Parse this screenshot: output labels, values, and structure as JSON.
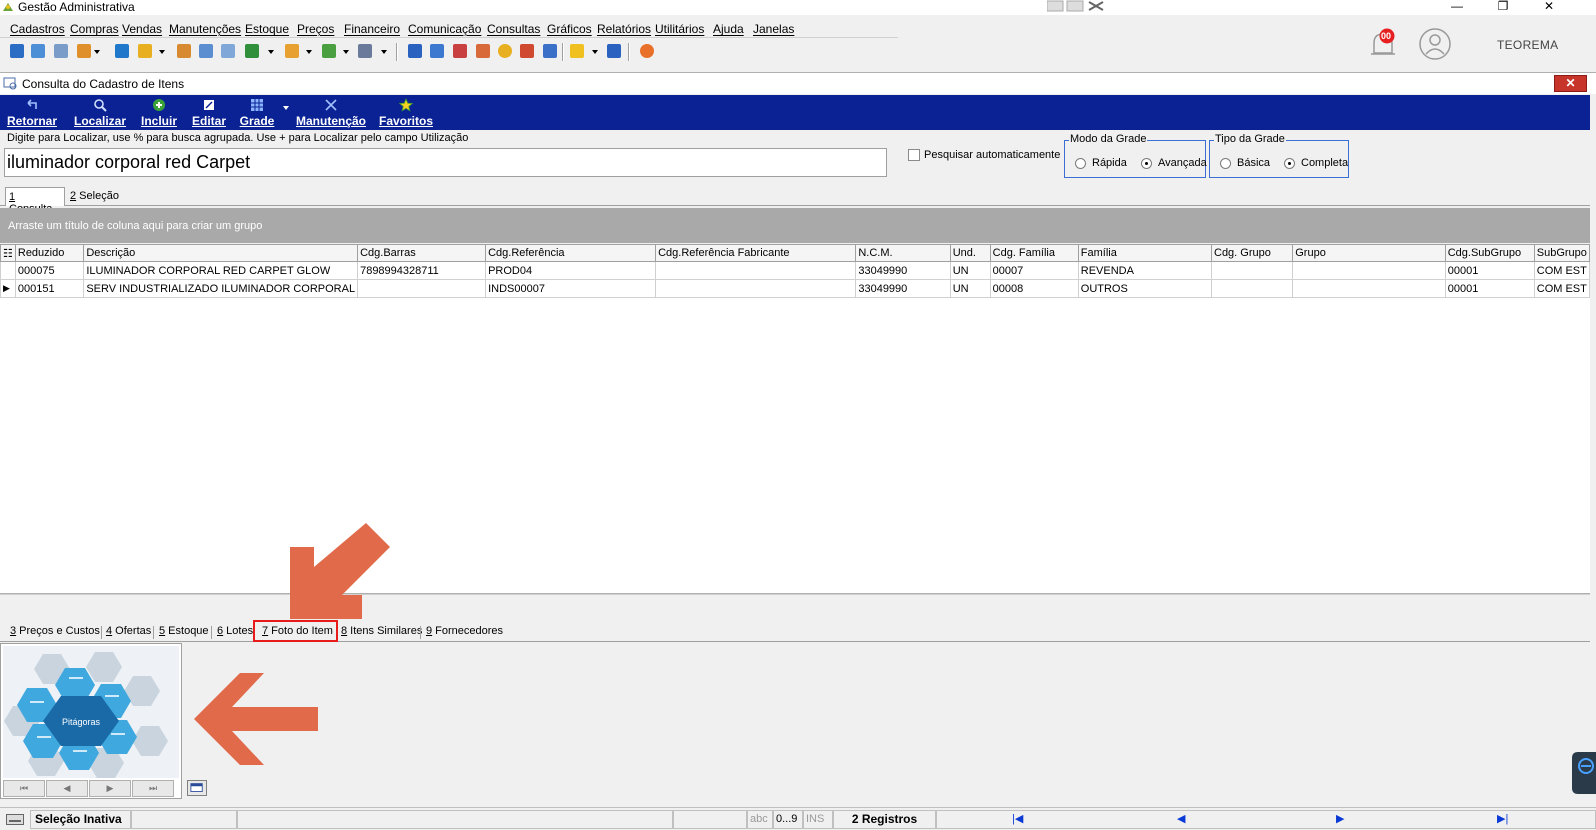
{
  "app": {
    "title": "Gestão Administrativa",
    "user": "TEOREMA",
    "notifications": "00"
  },
  "window_controls": {
    "minimize": "—",
    "restore": "❐",
    "close": "✕"
  },
  "menu": [
    "Cadastros",
    "Compras",
    "Vendas",
    "Manutenções",
    "Estoque",
    "Preços",
    "Financeiro",
    "Comunicação",
    "Consultas",
    "Gráficos",
    "Relatórios",
    "Utilitários",
    "Ajuda",
    "Janelas"
  ],
  "child_window": {
    "title": "Consulta do Cadastro de Itens",
    "close": "✕"
  },
  "actions": [
    "Retornar",
    "Localizar",
    "Incluir",
    "Editar",
    "Grade",
    "Manutenção",
    "Favoritos"
  ],
  "search": {
    "hint": "Digite para Localizar, use % para busca agrupada. Use + para Localizar pelo campo Utilização",
    "value": "iluminador corporal red Carpet",
    "auto_label": "Pesquisar automaticamente"
  },
  "modo_grade": {
    "title": "Modo da Grade",
    "options": [
      "Rápida",
      "Avançada"
    ],
    "selected": "Avançada"
  },
  "tipo_grade": {
    "title": "Tipo da Grade",
    "options": [
      "Básica",
      "Completa"
    ],
    "selected": "Completa"
  },
  "top_tabs": [
    {
      "num": "1",
      "label": " Consulta"
    },
    {
      "num": "2",
      "label": " Seleção"
    }
  ],
  "group_hint": "Arraste um título de coluna aqui para criar um grupo",
  "grid": {
    "columns": [
      "Reduzido",
      "Descrição",
      "Cdg.Barras",
      "Cdg.Referência",
      "Cdg.Referência Fabricante",
      "N.C.M.",
      "Und.",
      "Cdg. Família",
      "Família",
      "Cdg. Grupo",
      "Grupo",
      "Cdg.SubGrupo",
      "SubGrupo"
    ],
    "rows": [
      [
        "000075",
        "ILUMINADOR CORPORAL RED CARPET GLOW",
        "7898994328711",
        "PROD04",
        "",
        "33049990",
        "UN",
        "00007",
        "REVENDA",
        "",
        "",
        "00001",
        "COM EST"
      ],
      [
        "000151",
        "SERV INDUSTRIALIZADO ILUMINADOR CORPORAL",
        "",
        "INDS00007",
        "",
        "33049990",
        "UN",
        "00008",
        "OUTROS",
        "",
        "",
        "00001",
        "COM EST"
      ]
    ]
  },
  "bottom_tabs": [
    {
      "num": "3",
      "label": " Preços e Custos"
    },
    {
      "num": "4",
      "label": " Ofertas"
    },
    {
      "num": "5",
      "label": " Estoque"
    },
    {
      "num": "6",
      "label": " Lotes"
    },
    {
      "num": "7",
      "label": " Foto do Item"
    },
    {
      "num": "8",
      "label": " Itens Similares"
    },
    {
      "num": "9",
      "label": " Fornecedores"
    }
  ],
  "photo": {
    "center_label": "Pitágoras",
    "nav": [
      "⏮",
      "◀",
      "▶",
      "⏭"
    ]
  },
  "status": {
    "selection": "Seleção Inativa",
    "abc": "abc",
    "digits": "0...9",
    "ins": "INS",
    "records": "2 Registros",
    "nav": [
      "|◀",
      "◀",
      "▶",
      "▶|"
    ]
  },
  "colors": {
    "action_bar": "#0a2294",
    "highlight": "#e81b1b",
    "arrow": "#e06a4a"
  }
}
